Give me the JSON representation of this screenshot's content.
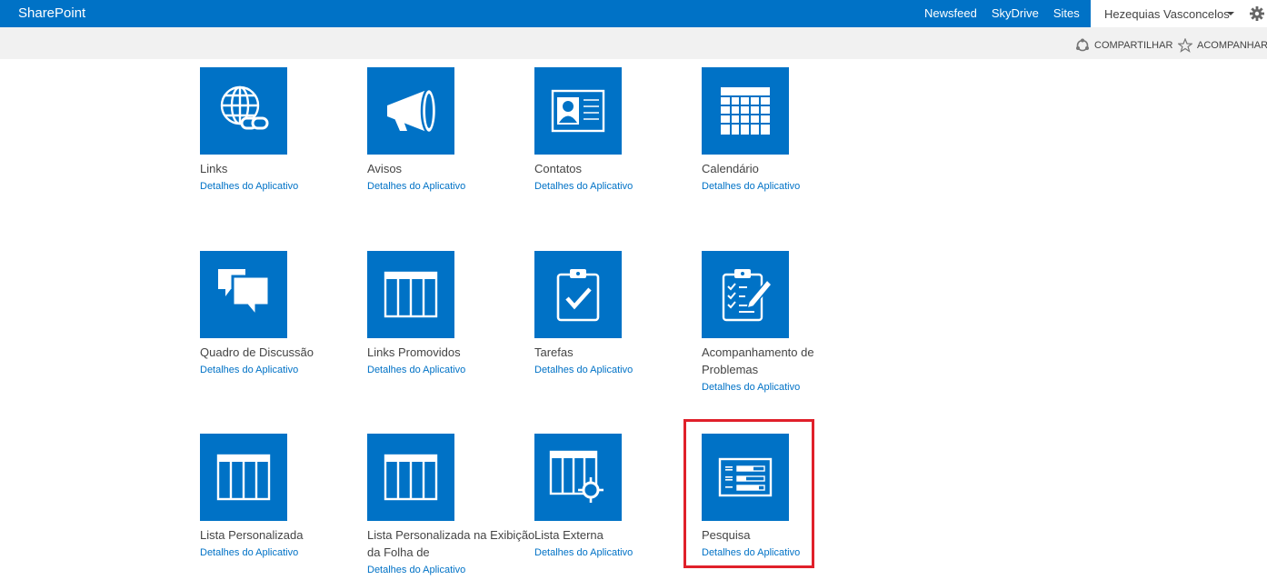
{
  "suite_bar": {
    "brand": "SharePoint",
    "links": [
      "Newsfeed",
      "SkyDrive",
      "Sites"
    ],
    "user": "Hezequias Vasconcelos",
    "settings_icon": "gear-icon"
  },
  "ribbon": {
    "share": "COMPARTILHAR",
    "follow": "ACOMPANHAR"
  },
  "apps": [
    {
      "title": "Links",
      "details": "Detalhes do Aplicativo",
      "icon": "globe-link-icon"
    },
    {
      "title": "Avisos",
      "details": "Detalhes do Aplicativo",
      "icon": "megaphone-icon"
    },
    {
      "title": "Contatos",
      "details": "Detalhes do Aplicativo",
      "icon": "contact-card-icon"
    },
    {
      "title": "Calendário",
      "details": "Detalhes do Aplicativo",
      "icon": "calendar-icon"
    },
    {
      "title": "Quadro de Discussão",
      "details": "Detalhes do Aplicativo",
      "icon": "discussion-icon"
    },
    {
      "title": "Links Promovidos",
      "details": "Detalhes do Aplicativo",
      "icon": "table-icon"
    },
    {
      "title": "Tarefas",
      "details": "Detalhes do Aplicativo",
      "icon": "task-clipboard-icon"
    },
    {
      "title": "Acompanhamento de Problemas",
      "details": "Detalhes do Aplicativo",
      "icon": "issue-clipboard-icon"
    },
    {
      "title": "Lista Personalizada",
      "details": "Detalhes do Aplicativo",
      "icon": "table-icon"
    },
    {
      "title": "Lista Personalizada na Exibição da Folha de",
      "details": "Detalhes do Aplicativo",
      "icon": "table-icon"
    },
    {
      "title": "Lista Externa",
      "details": "Detalhes do Aplicativo",
      "icon": "external-list-icon"
    },
    {
      "title": "Pesquisa",
      "details": "Detalhes do Aplicativo",
      "icon": "survey-icon"
    }
  ],
  "colors": {
    "brand_blue": "#0072c6",
    "highlight_red": "#e0202a"
  }
}
